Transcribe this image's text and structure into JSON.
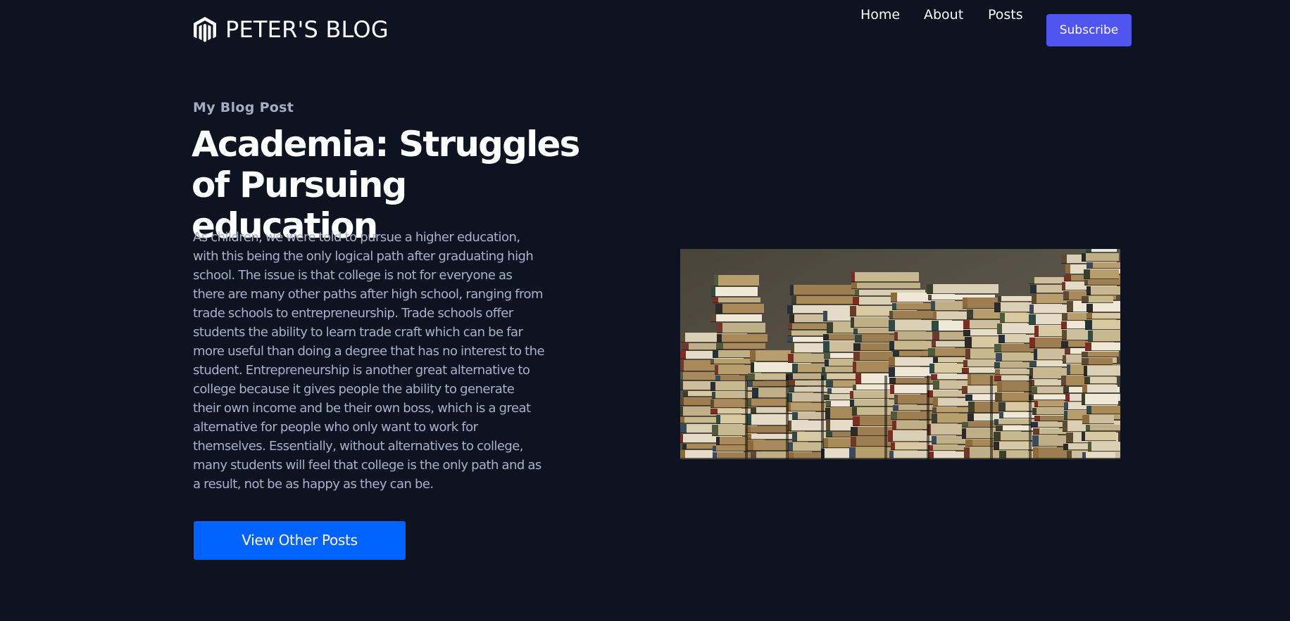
{
  "header": {
    "brand": {
      "icon": "magento-style-logo-icon",
      "name": "PETER'S BLOG"
    },
    "nav": {
      "items": [
        {
          "label": "Home"
        },
        {
          "label": "About"
        },
        {
          "label": "Posts"
        }
      ],
      "subscribe_label": "Subscribe"
    }
  },
  "main": {
    "eyebrow": "My Blog Post",
    "title": "Academia: Struggles of Pursuing education",
    "body": "As children, we were told to pursue a higher education, with this being the only logical path after graduating high school. The issue is that college is not for everyone as there are many other paths after high school, ranging from trade schools to entrepreneurship. Trade schools offer students the ability to learn trade craft which can be far more useful than doing a degree that has no interest to the student. Entrepreneurship is another great alternative to college because it gives people the ability to generate their own income and be their own boss, which is a great alternative for people who only want to work for themselves. Essentially, without alternatives to college, many students will feel that college is the only path and as a result, not be as happy as they can be.",
    "cta_label": "View Other Posts",
    "image": {
      "subject": "stacks-of-old-books-photo"
    }
  },
  "colors": {
    "background": "#0d1321",
    "subscribe_button": "#4f55ee",
    "cta_button": "#0062ff",
    "body_text": "#a8b2c6",
    "eyebrow_text": "#a3aec4"
  }
}
